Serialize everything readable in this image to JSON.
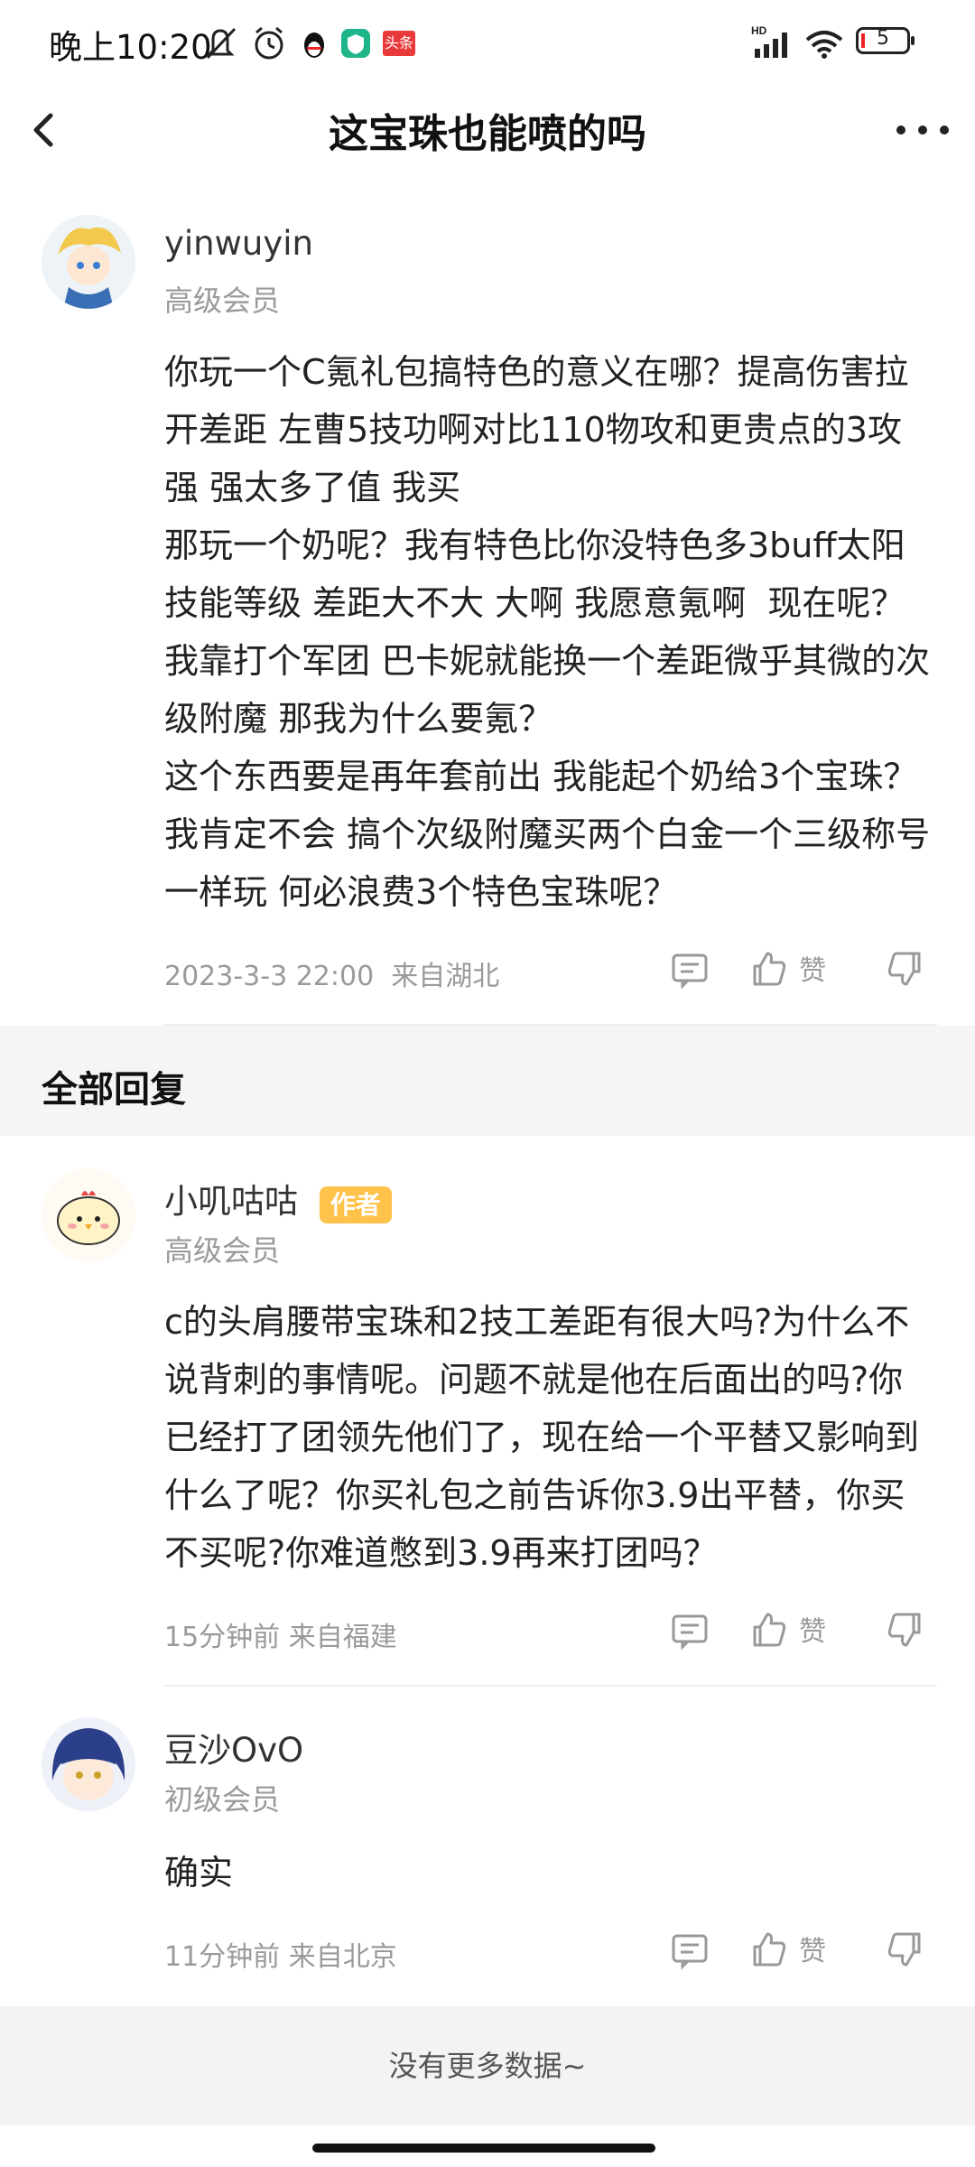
{
  "status": {
    "time": "晚上10:20",
    "battery": "5",
    "badge_text": "头条"
  },
  "nav": {
    "title": "这宝珠也能喷的吗"
  },
  "post": {
    "username": "yinwuyin",
    "level": "高级会员",
    "body": "你玩一个C氪礼包搞特色的意义在哪？提高伤害拉开差距 左曹5技功啊对比110物攻和更贵点的3攻强 强太多了值 我买\n那玩一个奶呢？我有特色比你没特色多3buff太阳技能等级 差距大不大 大啊 我愿意氪啊  现在呢？我靠打个军团 巴卡妮就能换一个差距微乎其微的次级附魔 那我为什么要氪？\n这个东西要是再年套前出 我能起个奶给3个宝珠？我肯定不会 搞个次级附魔买两个白金一个三级称号 一样玩 何必浪费3个特色宝珠呢？",
    "timestamp": "2023-3-3 22:00",
    "location": "来自湖北",
    "like_label": "赞"
  },
  "section": {
    "title": "全部回复"
  },
  "replies": [
    {
      "username": "小叽咕咕",
      "badge": "作者",
      "level": "高级会员",
      "body": "c的头肩腰带宝珠和2技工差距有很大吗?为什么不说背刺的事情呢。问题不就是他在后面出的吗?你已经打了团领先他们了，现在给一个平替又影响到什么了呢？你买礼包之前告诉你3.9出平替，你买不买呢?你难道憋到3.9再来打团吗？",
      "timestamp": "15分钟前",
      "location": "来自福建",
      "like_label": "赞"
    },
    {
      "username": "豆沙OvO",
      "level": "初级会员",
      "body": "确实",
      "timestamp": "11分钟前",
      "location": "来自北京",
      "like_label": "赞"
    }
  ],
  "footer": {
    "text": "没有更多数据~"
  }
}
